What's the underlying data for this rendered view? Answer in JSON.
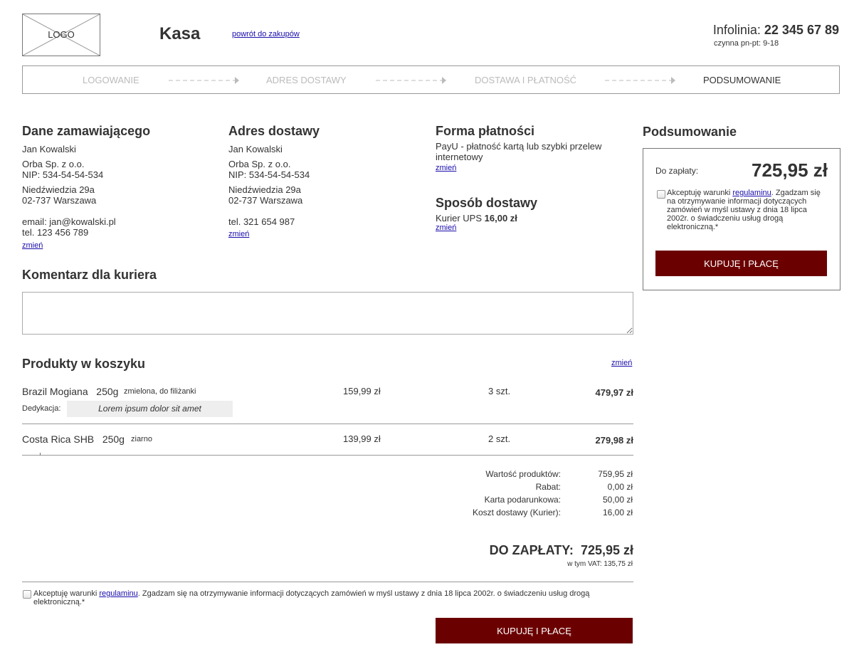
{
  "header": {
    "logo": "LOGO",
    "title": "Kasa",
    "back_link": "powrót do zakupów",
    "hotline_label": "Infolinia:",
    "hotline_number": "22 345 67 89",
    "hotline_hours": "czynna pn-pt: 9-18"
  },
  "steps": [
    {
      "label": "LOGOWANIE",
      "active": false
    },
    {
      "label": "ADRES DOSTAWY",
      "active": false
    },
    {
      "label": "DOSTAWA I PŁATNOŚĆ",
      "active": false
    },
    {
      "label": "PODSUMOWANIE",
      "active": true
    }
  ],
  "orderer": {
    "heading": "Dane zamawiającego",
    "name": "Jan Kowalski",
    "company": "Orba Sp. z o.o.",
    "nip": "NIP: 534-54-54-534",
    "street": "Niedźwiedzia 29a",
    "city": "02-737 Warszawa",
    "email": "email: jan@kowalski.pl",
    "phone": "tel. 123 456 789",
    "change": "zmień"
  },
  "delivery_address": {
    "heading": "Adres dostawy",
    "name": "Jan Kowalski",
    "company": "Orba Sp. z o.o.",
    "nip": "NIP: 534-54-54-534",
    "street": "Niedźwiedzia 29a",
    "city": "02-737 Warszawa",
    "phone": "tel. 321 654 987",
    "change": "zmień"
  },
  "payment": {
    "heading": "Forma płatności",
    "line1": "PayU - płatność kartą lub szybki przelew",
    "line2": "internetowy",
    "change": "zmień"
  },
  "shipping": {
    "heading": "Sposób dostawy",
    "method": "Kurier UPS",
    "price": "16,00 zł",
    "change": "zmień"
  },
  "comment": {
    "heading": "Komentarz dla kuriera",
    "value": ""
  },
  "products": {
    "heading": "Produkty w koszyku",
    "change": "zmień",
    "dedication_label": "Dedykacja:",
    "items": [
      {
        "name": "Brazil Mogiana",
        "weight": "250g",
        "desc": "zmielona, do filiżanki",
        "price": "159,99 zł",
        "qty": "3 szt.",
        "total": "479,97 zł",
        "dedication": "Lorem ipsum dolor sit amet"
      },
      {
        "name": "Costa Rica SHB",
        "weight": "250g",
        "desc": "ziarno",
        "price": "139,99 zł",
        "qty": "2 szt.",
        "total": "279,98 zł"
      }
    ]
  },
  "totals": {
    "lines": [
      {
        "label": "Wartość produktów:",
        "value": "759,95 zł"
      },
      {
        "label": "Rabat:",
        "value": "0,00 zł"
      },
      {
        "label": "Karta podarunkowa:",
        "value": "50,00 zł"
      },
      {
        "label": "Koszt dostawy (Kurier):",
        "value": "16,00 zł"
      }
    ],
    "grand_label": "DO ZAPŁATY:",
    "grand_value": "725,95 zł",
    "vat": "w tym VAT: 135,75 zł"
  },
  "terms": {
    "before": "Akceptuję warunki ",
    "link": "regulaminu",
    "after_bottom": ". Zgadzam się na otrzymywanie informacji dotyczących zamówień w myśl ustawy z dnia 18 lipca 2002r. o świadczeniu usług drogą",
    "after_bottom2": "elektroniczną.*",
    "side_line1_after": ". Zgadzam się",
    "side_line2": "na otrzymywanie informacji dotyczących",
    "side_line3": "zamówień w myśl ustawy z dnia 18 lipca",
    "side_line4": "2002r. o świadczeniu usług drogą",
    "side_line5": "elektroniczną.*"
  },
  "summary_side": {
    "heading": "Podsumowanie",
    "to_pay_label": "Do zapłaty:",
    "to_pay_value": "725,95 zł"
  },
  "buy_button": "KUPUJĘ I PŁACĘ",
  "colors": {
    "accent": "#6b0000"
  }
}
